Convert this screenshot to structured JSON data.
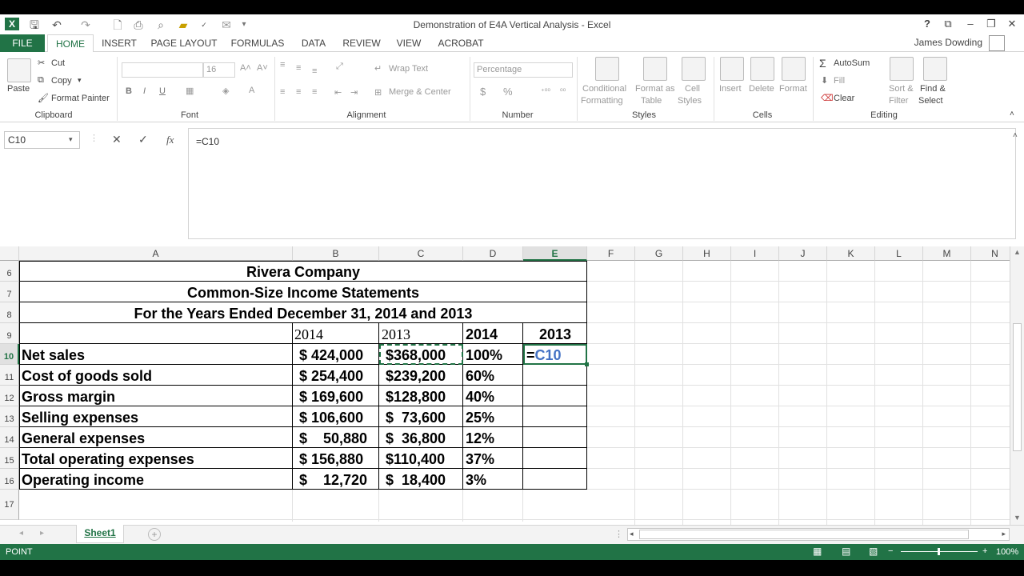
{
  "window": {
    "title": "Demonstration of E4A Vertical  Analysis - Excel",
    "help": "?",
    "restore_ribbon": "⧉",
    "minimize": "–",
    "maximize": "❐",
    "close": "✕"
  },
  "qat": {
    "customize": "▾"
  },
  "tabs": {
    "file": "FILE",
    "home": "HOME",
    "insert": "INSERT",
    "page_layout": "PAGE LAYOUT",
    "formulas": "FORMULAS",
    "data": "DATA",
    "review": "REVIEW",
    "view": "VIEW",
    "acrobat": "ACROBAT",
    "user": "James Dowding"
  },
  "ribbon": {
    "clipboard": {
      "paste": "Paste",
      "cut": "Cut",
      "copy": "Copy",
      "format_painter": "Format Painter",
      "label": "Clipboard"
    },
    "font": {
      "size": "16",
      "bold": "B",
      "italic": "I",
      "underline": "U",
      "grow": "A˄",
      "shrink": "A˅",
      "label": "Font"
    },
    "alignment": {
      "wrap_text": "Wrap Text",
      "merge_center": "Merge & Center",
      "label": "Alignment"
    },
    "number": {
      "format": "Percentage",
      "currency": "$",
      "percent": "%",
      "label": "Number"
    },
    "styles": {
      "conditional": "Conditional",
      "formatting": "Formatting",
      "format_as": "Format as",
      "table": "Table",
      "cell": "Cell",
      "styles_word": "Styles",
      "label": "Styles"
    },
    "cells": {
      "insert": "Insert",
      "delete": "Delete",
      "format": "Format",
      "label": "Cells"
    },
    "editing": {
      "autosum": "AutoSum",
      "fill": "Fill",
      "clear": "Clear",
      "sort": "Sort &",
      "filter": "Filter",
      "find": "Find &",
      "select": "Select",
      "label": "Editing"
    }
  },
  "formula_bar": {
    "name_box": "C10",
    "cancel": "✕",
    "enter": "✓",
    "fx": "fx",
    "formula": "=C10"
  },
  "columns": [
    "A",
    "B",
    "C",
    "D",
    "E",
    "F",
    "G",
    "H",
    "I",
    "J",
    "K",
    "L",
    "M",
    "N"
  ],
  "rows": [
    "6",
    "7",
    "8",
    "9",
    "10",
    "11",
    "12",
    "13",
    "14",
    "15",
    "16",
    "17"
  ],
  "sheet": {
    "title1": "Rivera Company",
    "title2": "Common-Size Income Statements",
    "title3": "For the Years Ended December 31, 2014 and 2013",
    "hdr_b": "2014",
    "hdr_c": "2013",
    "hdr_d": "2014",
    "hdr_e": "2013",
    "data_rows": [
      {
        "label": "Net sales",
        "b": "$ 424,000",
        "c": "$368,000",
        "d": "100%",
        "e": "=C10"
      },
      {
        "label": "Cost of goods sold",
        "b": "$ 254,400",
        "c": "$239,200",
        "d": "60%",
        "e": ""
      },
      {
        "label": "Gross margin",
        "b": "$ 169,600",
        "c": "$128,800",
        "d": "40%",
        "e": ""
      },
      {
        "label": "Selling expenses",
        "b": "$ 106,600",
        "c": "$  73,600",
        "d": "25%",
        "e": ""
      },
      {
        "label": "General expenses",
        "b": "$    50,880",
        "c": "$  36,800",
        "d": "12%",
        "e": ""
      },
      {
        "label": "Total operating expenses",
        "b": "$ 156,880",
        "c": "$110,400",
        "d": "37%",
        "e": ""
      },
      {
        "label": "Operating income",
        "b": "$    12,720",
        "c": "$  18,400",
        "d": "3%",
        "e": ""
      }
    ]
  },
  "sheet_tabs": {
    "active": "Sheet1",
    "add": "+"
  },
  "status": {
    "mode": "POINT",
    "zoom": "100%"
  },
  "colors": {
    "excel_green": "#217346",
    "ref_blue": "#4472c4"
  }
}
